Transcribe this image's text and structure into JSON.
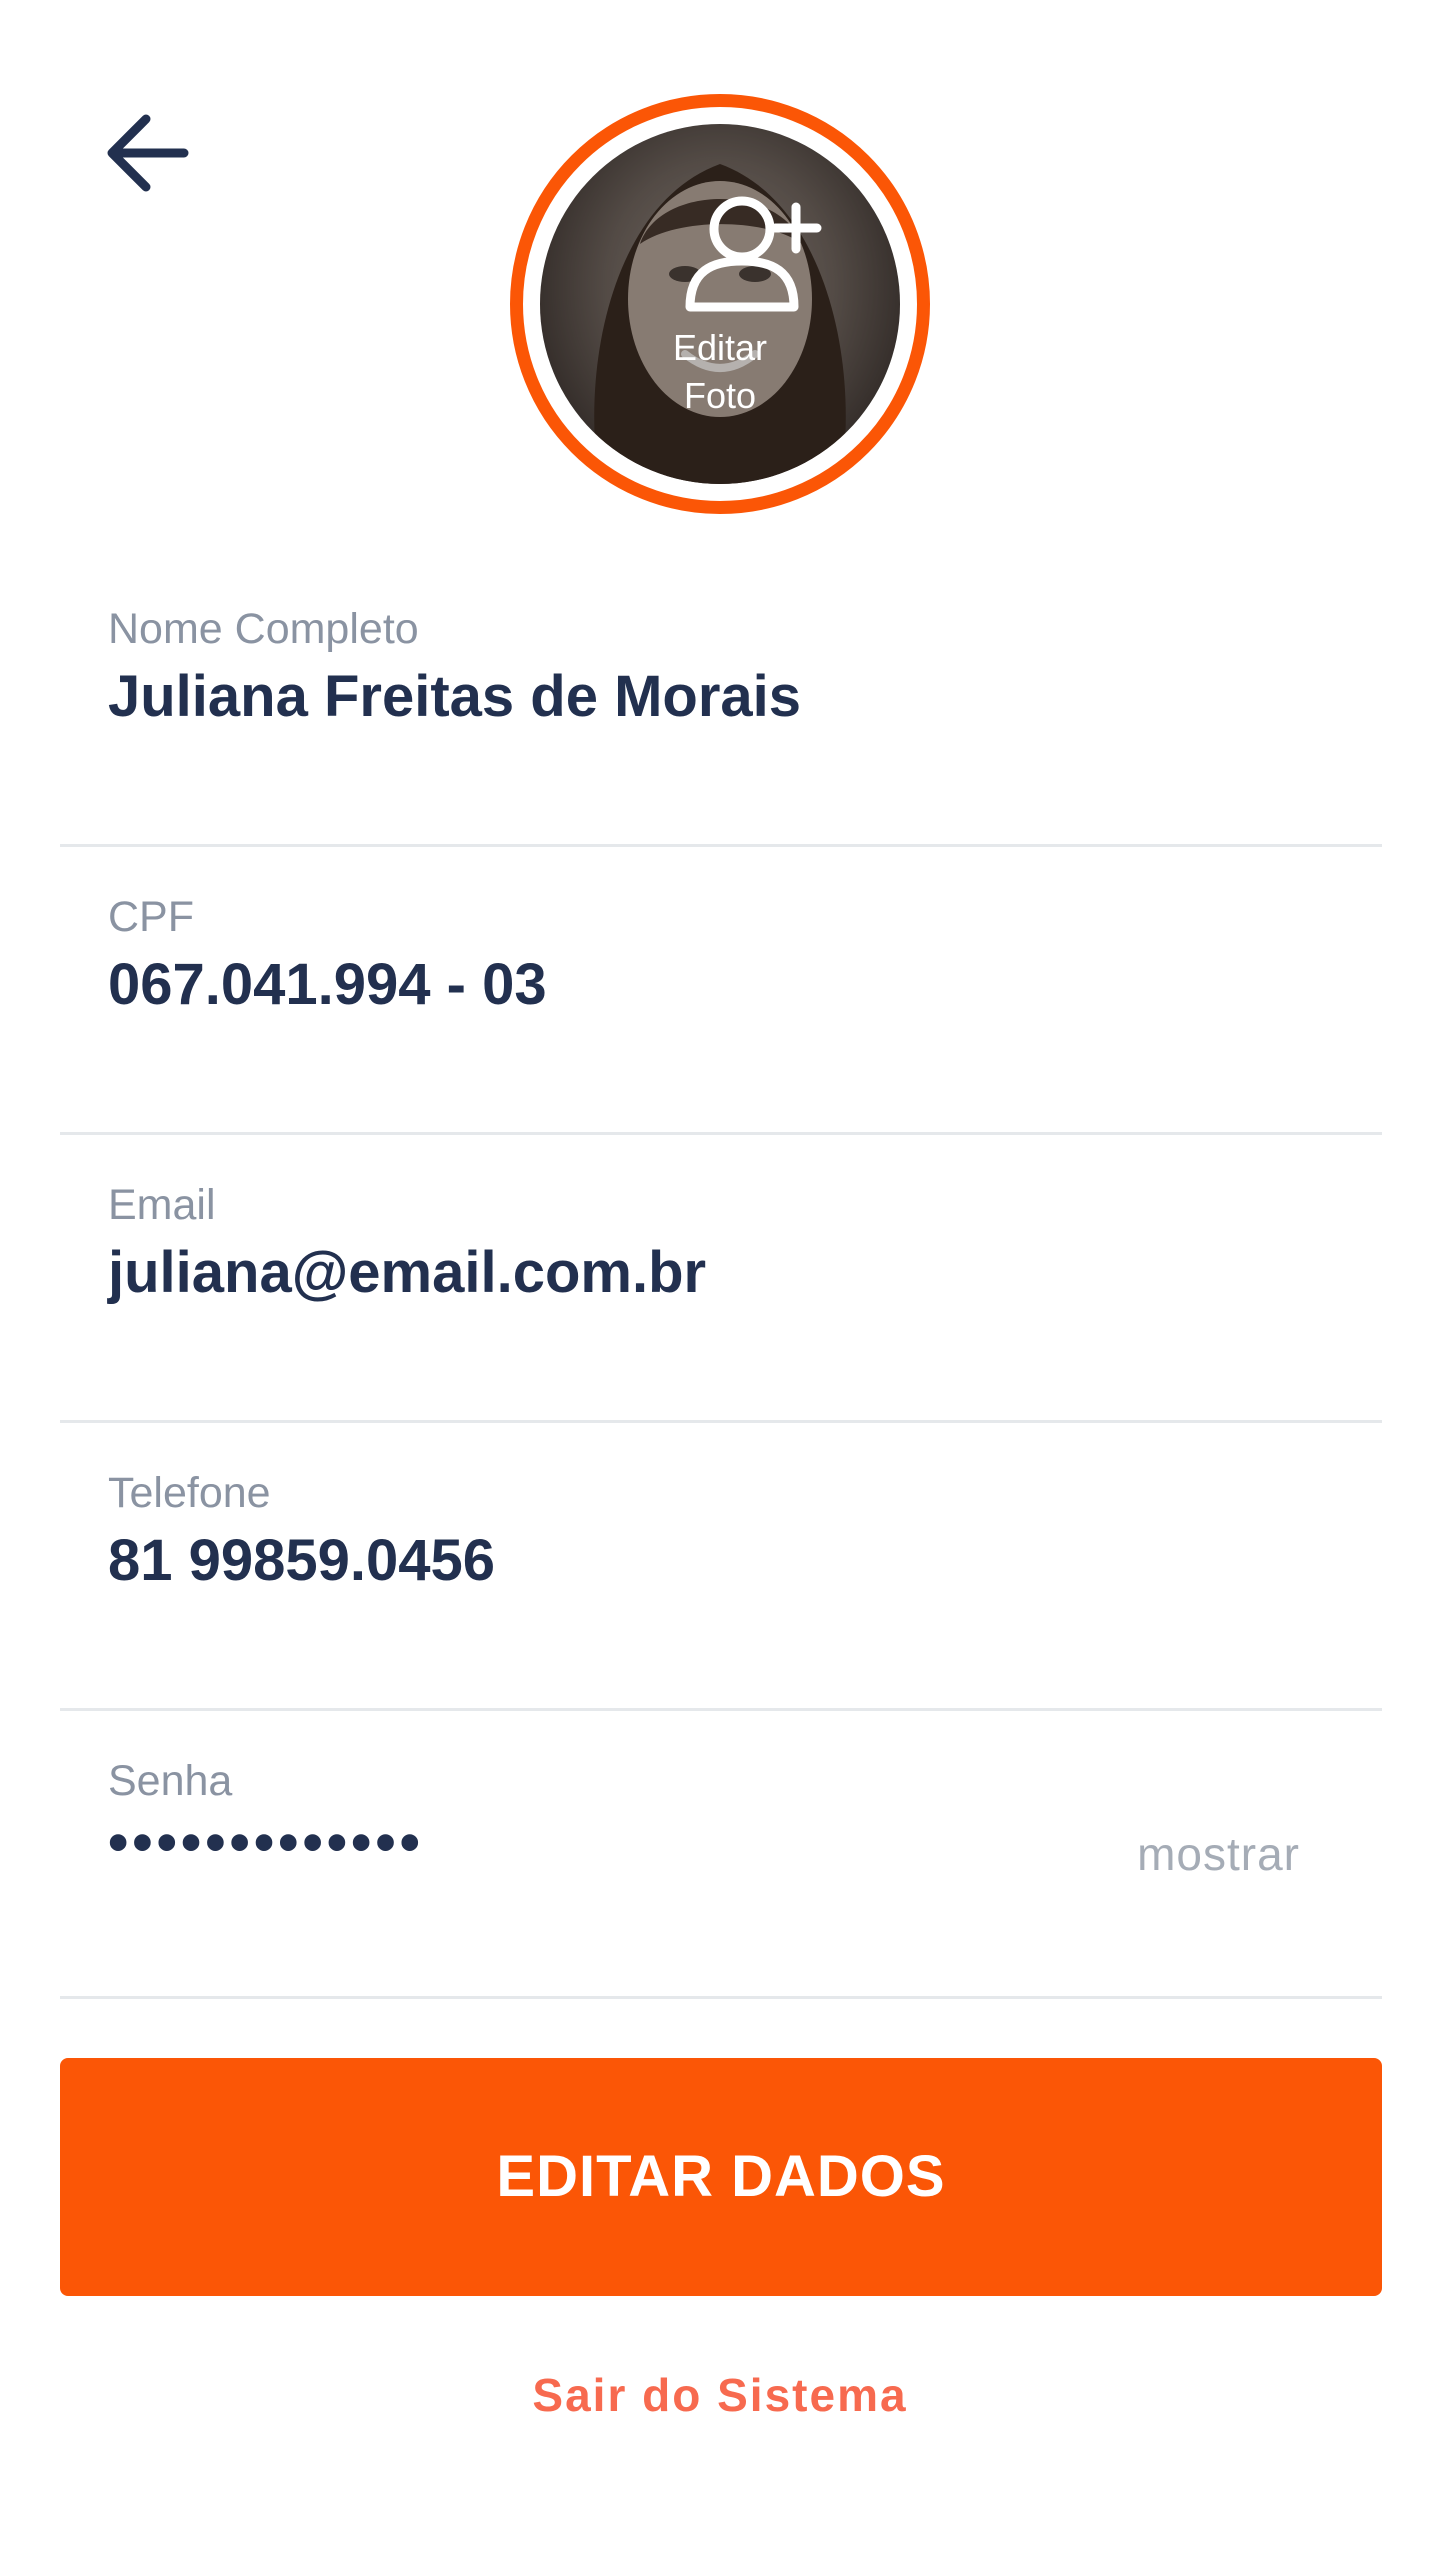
{
  "header": {
    "back_icon": "arrow-left-icon",
    "edit_photo_icon": "user-plus-icon",
    "edit_photo_line1": "Editar",
    "edit_photo_line2": "Foto"
  },
  "fields": [
    {
      "label": "Nome Completo",
      "value": "Juliana Freitas de Morais"
    },
    {
      "label": "CPF",
      "value": "067.041.994 - 03"
    },
    {
      "label": "Email",
      "value": "juliana@email.com.br"
    },
    {
      "label": "Telefone",
      "value": "81 99859.0456"
    },
    {
      "label": "Senha",
      "value": "•••••••••••••",
      "action": "mostrar"
    }
  ],
  "actions": {
    "edit_button": "EDITAR DADOS",
    "logout_link": "Sair do Sistema"
  },
  "colors": {
    "accent": "#fb5606",
    "text_primary": "#22304f",
    "text_label": "#8a93a2",
    "logout": "#f76a4f",
    "divider": "#e5e8eb"
  }
}
